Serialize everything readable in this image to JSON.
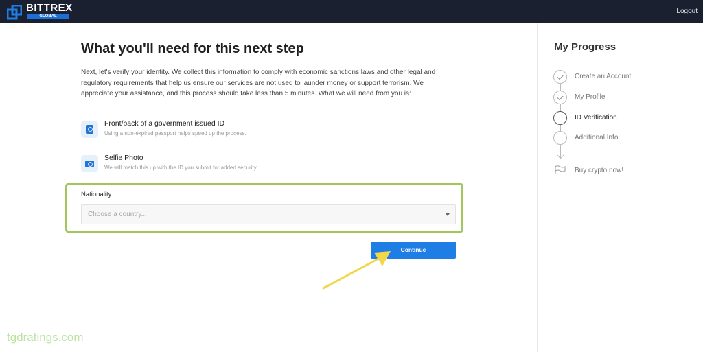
{
  "header": {
    "brand": "BITTREX",
    "brand_sub": "GLOBAL",
    "logout_label": "Logout"
  },
  "main": {
    "title": "What you'll need for this next step",
    "intro": "Next, let's verify your identity. We collect this information to comply with economic sanctions laws and other legal and regulatory requirements that help us ensure our services are not used to launder money or support terrorism. We appreciate your assistance, and this process should take less than 5 minutes. What we will need from you is:",
    "requirements": [
      {
        "icon": "passport-icon",
        "title": "Front/back of a government issued ID",
        "subtitle": "Using a non-expired passport helps speed up the process."
      },
      {
        "icon": "camera-icon",
        "title": "Selfie Photo",
        "subtitle": "We will match this up with the ID you submit for added security."
      }
    ],
    "nationality": {
      "label": "Nationality",
      "placeholder": "Choose a country..."
    },
    "continue_label": "Continue"
  },
  "sidebar": {
    "title": "My Progress",
    "steps": [
      {
        "label": "Create an Account",
        "state": "done"
      },
      {
        "label": "My Profile",
        "state": "done"
      },
      {
        "label": "ID Verification",
        "state": "current"
      },
      {
        "label": "Additional Info",
        "state": "pending"
      },
      {
        "label": "Buy crypto now!",
        "state": "final"
      }
    ]
  },
  "colors": {
    "header_bg": "#1b2030",
    "accent_blue": "#1e7ee6",
    "highlight_green": "#a4c45c",
    "annotation_arrow": "#f2d64b"
  },
  "watermark": "tgdratings.com"
}
